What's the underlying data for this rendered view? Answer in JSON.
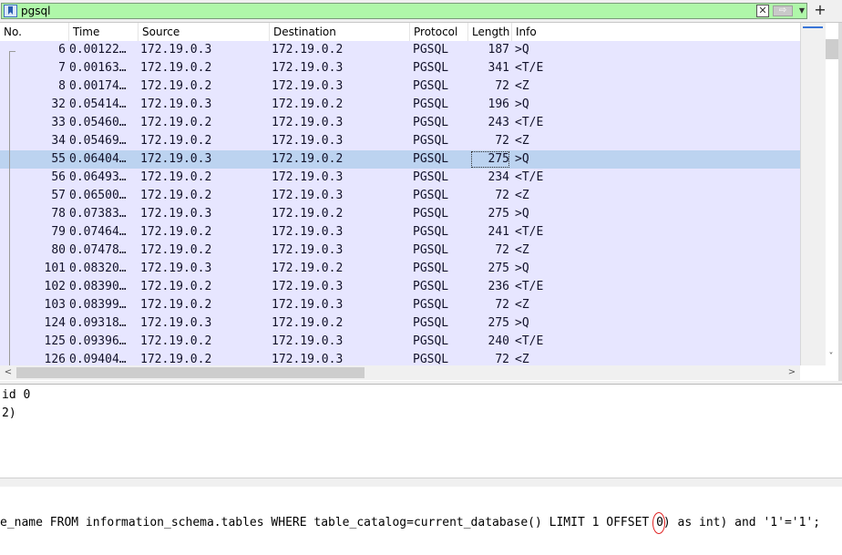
{
  "filter": {
    "value": "pgsql",
    "clear_glyph": "✕",
    "apply_glyph": "⇨",
    "dropdown_glyph": "▼",
    "add_glyph": "+"
  },
  "columns": [
    "No.",
    "Time",
    "Source",
    "Destination",
    "Protocol",
    "Length",
    "Info"
  ],
  "packets": [
    {
      "no": "6",
      "time": "0.00122…",
      "src": "172.19.0.3",
      "dst": "172.19.0.2",
      "proto": "PGSQL",
      "len": "187",
      "info": ">Q"
    },
    {
      "no": "7",
      "time": "0.00163…",
      "src": "172.19.0.2",
      "dst": "172.19.0.3",
      "proto": "PGSQL",
      "len": "341",
      "info": "<T/E"
    },
    {
      "no": "8",
      "time": "0.00174…",
      "src": "172.19.0.2",
      "dst": "172.19.0.3",
      "proto": "PGSQL",
      "len": "72",
      "info": "<Z"
    },
    {
      "no": "32",
      "time": "0.05414…",
      "src": "172.19.0.3",
      "dst": "172.19.0.2",
      "proto": "PGSQL",
      "len": "196",
      "info": ">Q"
    },
    {
      "no": "33",
      "time": "0.05460…",
      "src": "172.19.0.2",
      "dst": "172.19.0.3",
      "proto": "PGSQL",
      "len": "243",
      "info": "<T/E"
    },
    {
      "no": "34",
      "time": "0.05469…",
      "src": "172.19.0.2",
      "dst": "172.19.0.3",
      "proto": "PGSQL",
      "len": "72",
      "info": "<Z"
    },
    {
      "no": "55",
      "time": "0.06404…",
      "src": "172.19.0.3",
      "dst": "172.19.0.2",
      "proto": "PGSQL",
      "len": "275",
      "info": ">Q",
      "selected": true
    },
    {
      "no": "56",
      "time": "0.06493…",
      "src": "172.19.0.2",
      "dst": "172.19.0.3",
      "proto": "PGSQL",
      "len": "234",
      "info": "<T/E"
    },
    {
      "no": "57",
      "time": "0.06500…",
      "src": "172.19.0.2",
      "dst": "172.19.0.3",
      "proto": "PGSQL",
      "len": "72",
      "info": "<Z"
    },
    {
      "no": "78",
      "time": "0.07383…",
      "src": "172.19.0.3",
      "dst": "172.19.0.2",
      "proto": "PGSQL",
      "len": "275",
      "info": ">Q"
    },
    {
      "no": "79",
      "time": "0.07464…",
      "src": "172.19.0.2",
      "dst": "172.19.0.3",
      "proto": "PGSQL",
      "len": "241",
      "info": "<T/E"
    },
    {
      "no": "80",
      "time": "0.07478…",
      "src": "172.19.0.2",
      "dst": "172.19.0.3",
      "proto": "PGSQL",
      "len": "72",
      "info": "<Z"
    },
    {
      "no": "101",
      "time": "0.08320…",
      "src": "172.19.0.3",
      "dst": "172.19.0.2",
      "proto": "PGSQL",
      "len": "275",
      "info": ">Q"
    },
    {
      "no": "102",
      "time": "0.08390…",
      "src": "172.19.0.2",
      "dst": "172.19.0.3",
      "proto": "PGSQL",
      "len": "236",
      "info": "<T/E"
    },
    {
      "no": "103",
      "time": "0.08399…",
      "src": "172.19.0.2",
      "dst": "172.19.0.3",
      "proto": "PGSQL",
      "len": "72",
      "info": "<Z"
    },
    {
      "no": "124",
      "time": "0.09318…",
      "src": "172.19.0.3",
      "dst": "172.19.0.2",
      "proto": "PGSQL",
      "len": "275",
      "info": ">Q"
    },
    {
      "no": "125",
      "time": "0.09396…",
      "src": "172.19.0.2",
      "dst": "172.19.0.3",
      "proto": "PGSQL",
      "len": "240",
      "info": "<T/E"
    },
    {
      "no": "126",
      "time": "0.09404…",
      "src": "172.19.0.2",
      "dst": "172.19.0.3",
      "proto": "PGSQL",
      "len": "72",
      "info": "<Z"
    }
  ],
  "scroll": {
    "up_glyph": "▲",
    "down_glyph": "˅",
    "left_glyph": "<",
    "right_glyph": ">"
  },
  "detail": {
    "lines": [
      "id 0",
      "2)"
    ]
  },
  "query": {
    "before": "e_name FROM information_schema.tables WHERE table_catalog=current_database() LIMIT 1 OFFSET ",
    "highlight": "0",
    "after": ") as int) and '1'='1';"
  },
  "colors": {
    "filter_valid_bg": "#aff7a9",
    "row_bg": "#e7e6ff",
    "selected_row_bg": "#bcd3f0",
    "annotation_circle": "#e02020"
  }
}
